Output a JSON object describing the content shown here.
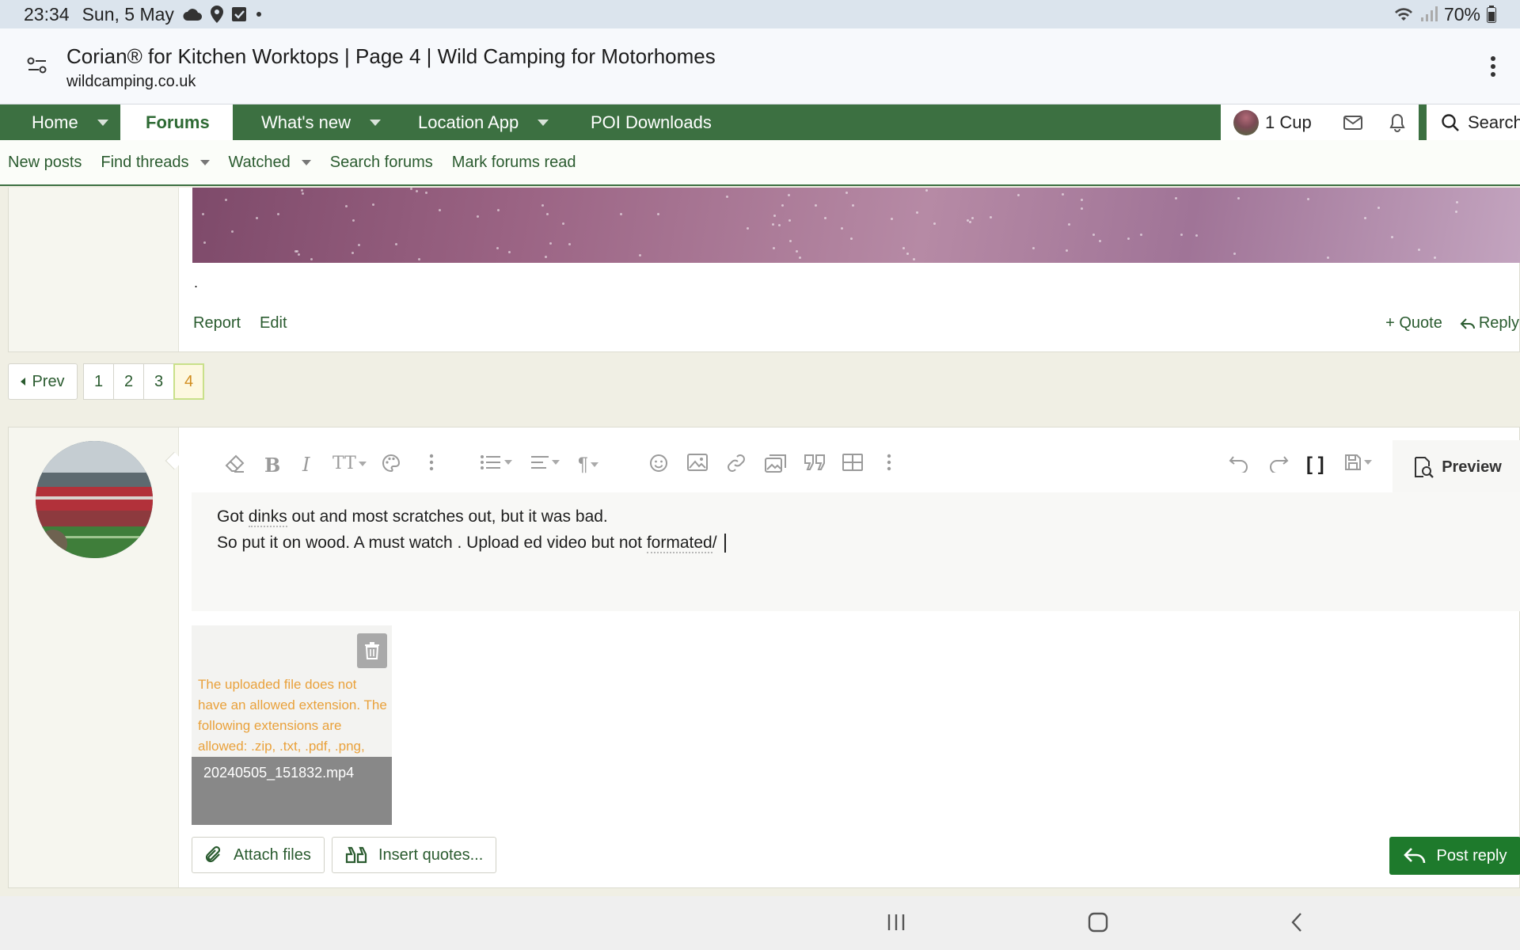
{
  "status_bar": {
    "time": "23:34",
    "date": "Sun, 5 May",
    "battery": "70%",
    "icons": [
      "cloud-icon",
      "location-pin-icon",
      "checkbox-icon",
      "dot-icon",
      "wifi-icon",
      "signal-icon",
      "battery-icon"
    ]
  },
  "browser": {
    "title": "Corian® for Kitchen Worktops | Page 4 | Wild Camping for Motorhomes",
    "url": "wildcamping.co.uk"
  },
  "nav": {
    "home": "Home",
    "forums": "Forums",
    "whats_new": "What's new",
    "location_app": "Location App",
    "poi_downloads": "POI Downloads",
    "user": "1 Cup",
    "search": "Search",
    "accent": "#3c7041"
  },
  "subnav": {
    "new_posts": "New posts",
    "find_threads": "Find threads",
    "watched": "Watched",
    "search_forums": "Search forums",
    "mark_read": "Mark forums read"
  },
  "post": {
    "body": ".",
    "report": "Report",
    "edit": "Edit",
    "quote": "+ Quote",
    "reply": "Reply"
  },
  "pagination": {
    "prev": "Prev",
    "pages": [
      "1",
      "2",
      "3",
      "4"
    ],
    "current": "4"
  },
  "editor": {
    "line1_a": "Got ",
    "line1_word": "dinks",
    "line1_b": " out and most scratches out,  but it was bad.",
    "line2_a": "So put it on wood. A must watch . Upload ed video but not ",
    "line2_word": "formated",
    "line2_b": "/ ",
    "preview": "Preview"
  },
  "attachment": {
    "error": "The uploaded file does not have an allowed extension. The following extensions are allowed: .zip, .txt, .pdf, .png,",
    "filename": "20240505_151832.mp4"
  },
  "actions": {
    "attach": "Attach files",
    "insert_quotes": "Insert quotes...",
    "post_reply": "Post reply",
    "post_reply_color": "#1e7a2c"
  }
}
